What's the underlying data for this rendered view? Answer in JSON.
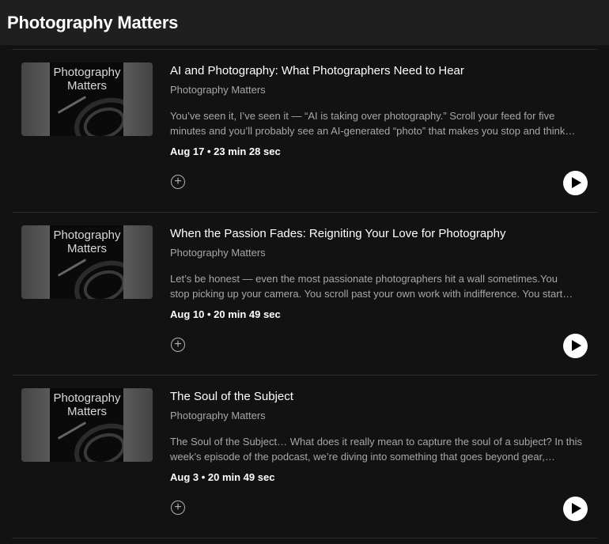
{
  "header": {
    "title": "Photography Matters"
  },
  "cover": {
    "line1": "Photography",
    "line2": "Matters"
  },
  "episodes": [
    {
      "title": "AI and Photography: What Photographers Need to Hear",
      "show": "Photography Matters",
      "desc_line1": "You’ve seen it, I’ve seen it — “AI is taking over photography.” Scroll your feed for five",
      "desc_line2": "minutes and you’ll probably see an AI-generated “photo” that makes you stop and think…",
      "meta": "Aug 17 • 23 min 28 sec",
      "add_icon": "plus-circle-icon",
      "play_icon": "play-icon"
    },
    {
      "title": "When the Passion Fades: Reigniting Your Love for Photography",
      "show": "Photography Matters",
      "desc_line1": "Let’s be honest — even the most passionate photographers hit a wall sometimes.You",
      "desc_line2": "stop picking up your camera. You scroll past your own work with indifference. You start…",
      "meta": "Aug 10 • 20 min 49 sec",
      "add_icon": "plus-circle-icon",
      "play_icon": "play-icon"
    },
    {
      "title": "The Soul of the Subject",
      "show": "Photography Matters",
      "desc_line1": "The Soul of the Subject… What does it really mean to capture the soul of a subject? In this",
      "desc_line2": "week’s episode of the podcast, we’re diving into something that goes beyond gear,…",
      "meta": "Aug 3 • 20 min 49 sec",
      "add_icon": "plus-circle-icon",
      "play_icon": "play-icon"
    }
  ],
  "colors": {
    "background": "#121212",
    "header": "#1f1f1f",
    "muted_text": "#a7a7a7",
    "divider": "#2a2a2a"
  }
}
